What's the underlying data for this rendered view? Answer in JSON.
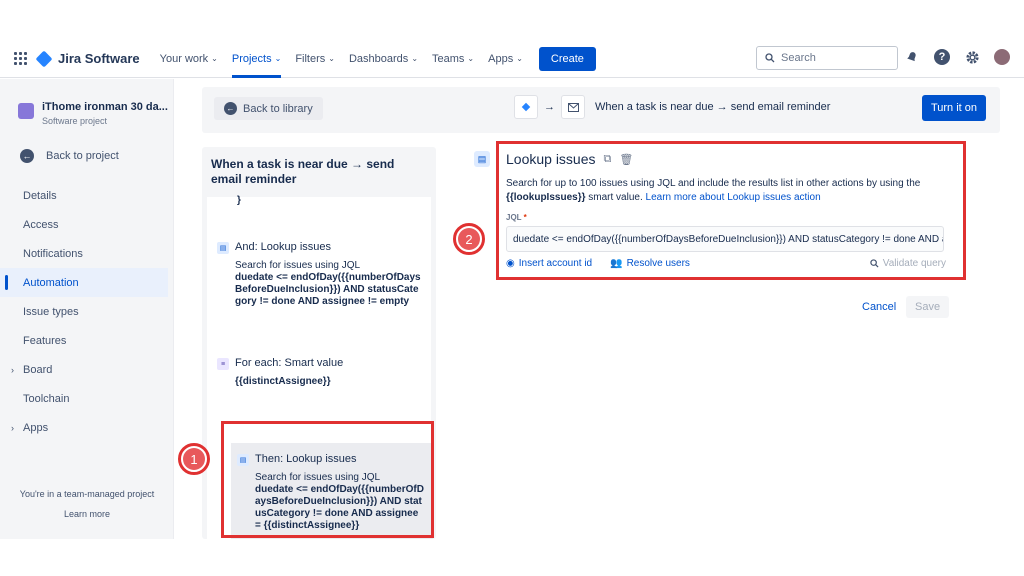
{
  "topbar": {
    "app_name": "Jira Software",
    "nav": [
      {
        "label": "Your work"
      },
      {
        "label": "Projects"
      },
      {
        "label": "Filters"
      },
      {
        "label": "Dashboards"
      },
      {
        "label": "Teams"
      },
      {
        "label": "Apps"
      }
    ],
    "create_label": "Create",
    "search_placeholder": "Search"
  },
  "sidebar": {
    "project_name": "iThome ironman 30 da...",
    "project_type": "Software project",
    "back_label": "Back to project",
    "items": [
      {
        "label": "Details"
      },
      {
        "label": "Access"
      },
      {
        "label": "Notifications"
      },
      {
        "label": "Automation"
      },
      {
        "label": "Issue types"
      },
      {
        "label": "Features"
      },
      {
        "label": "Board"
      },
      {
        "label": "Toolchain"
      },
      {
        "label": "Apps"
      }
    ],
    "team_note": "You're in a team-managed project",
    "learn_more": "Learn more"
  },
  "header": {
    "back_library": "Back to library",
    "flow_text": "When a task is near due → send email reminder",
    "turn_on": "Turn it on"
  },
  "rule": {
    "title": "When a task is near due → send email reminder",
    "steps": [
      {
        "title": "And: Lookup issues",
        "desc": "Search for issues using JQL",
        "jql": "duedate <= endOfDay({{numberOfDaysBeforeDueInclusion}}) AND statusCategory != done AND assignee != empty"
      },
      {
        "title": "For each: Smart value",
        "jql": "{{distinctAssignee}}"
      },
      {
        "title": "Then: Lookup issues",
        "desc": "Search for issues using JQL",
        "jql": "duedate <= endOfDay({{numberOfDaysBeforeDueInclusion}}) AND statusCategory != done AND assignee = {{distinctAssignee}}"
      }
    ]
  },
  "detail": {
    "title": "Lookup issues",
    "desc_part1": "Search for up to 100 issues using JQL and include the results list in other actions by using the ",
    "desc_smart": "{{lookupIssues}}",
    "desc_part2": " smart value. ",
    "desc_link": "Learn more about Lookup issues action",
    "jql_label": "JQL",
    "jql_value": "duedate <= endOfDay({{numberOfDaysBeforeDueInclusion}}) AND statusCategory != done AND assignee = {{distinctAssignee}}",
    "insert_account": "Insert account id",
    "resolve_users": "Resolve users",
    "validate": "Validate query",
    "cancel": "Cancel",
    "save": "Save"
  },
  "annotations": [
    "1",
    "2"
  ],
  "colors": {
    "accent": "#0052cc",
    "highlight": "#e03131"
  }
}
